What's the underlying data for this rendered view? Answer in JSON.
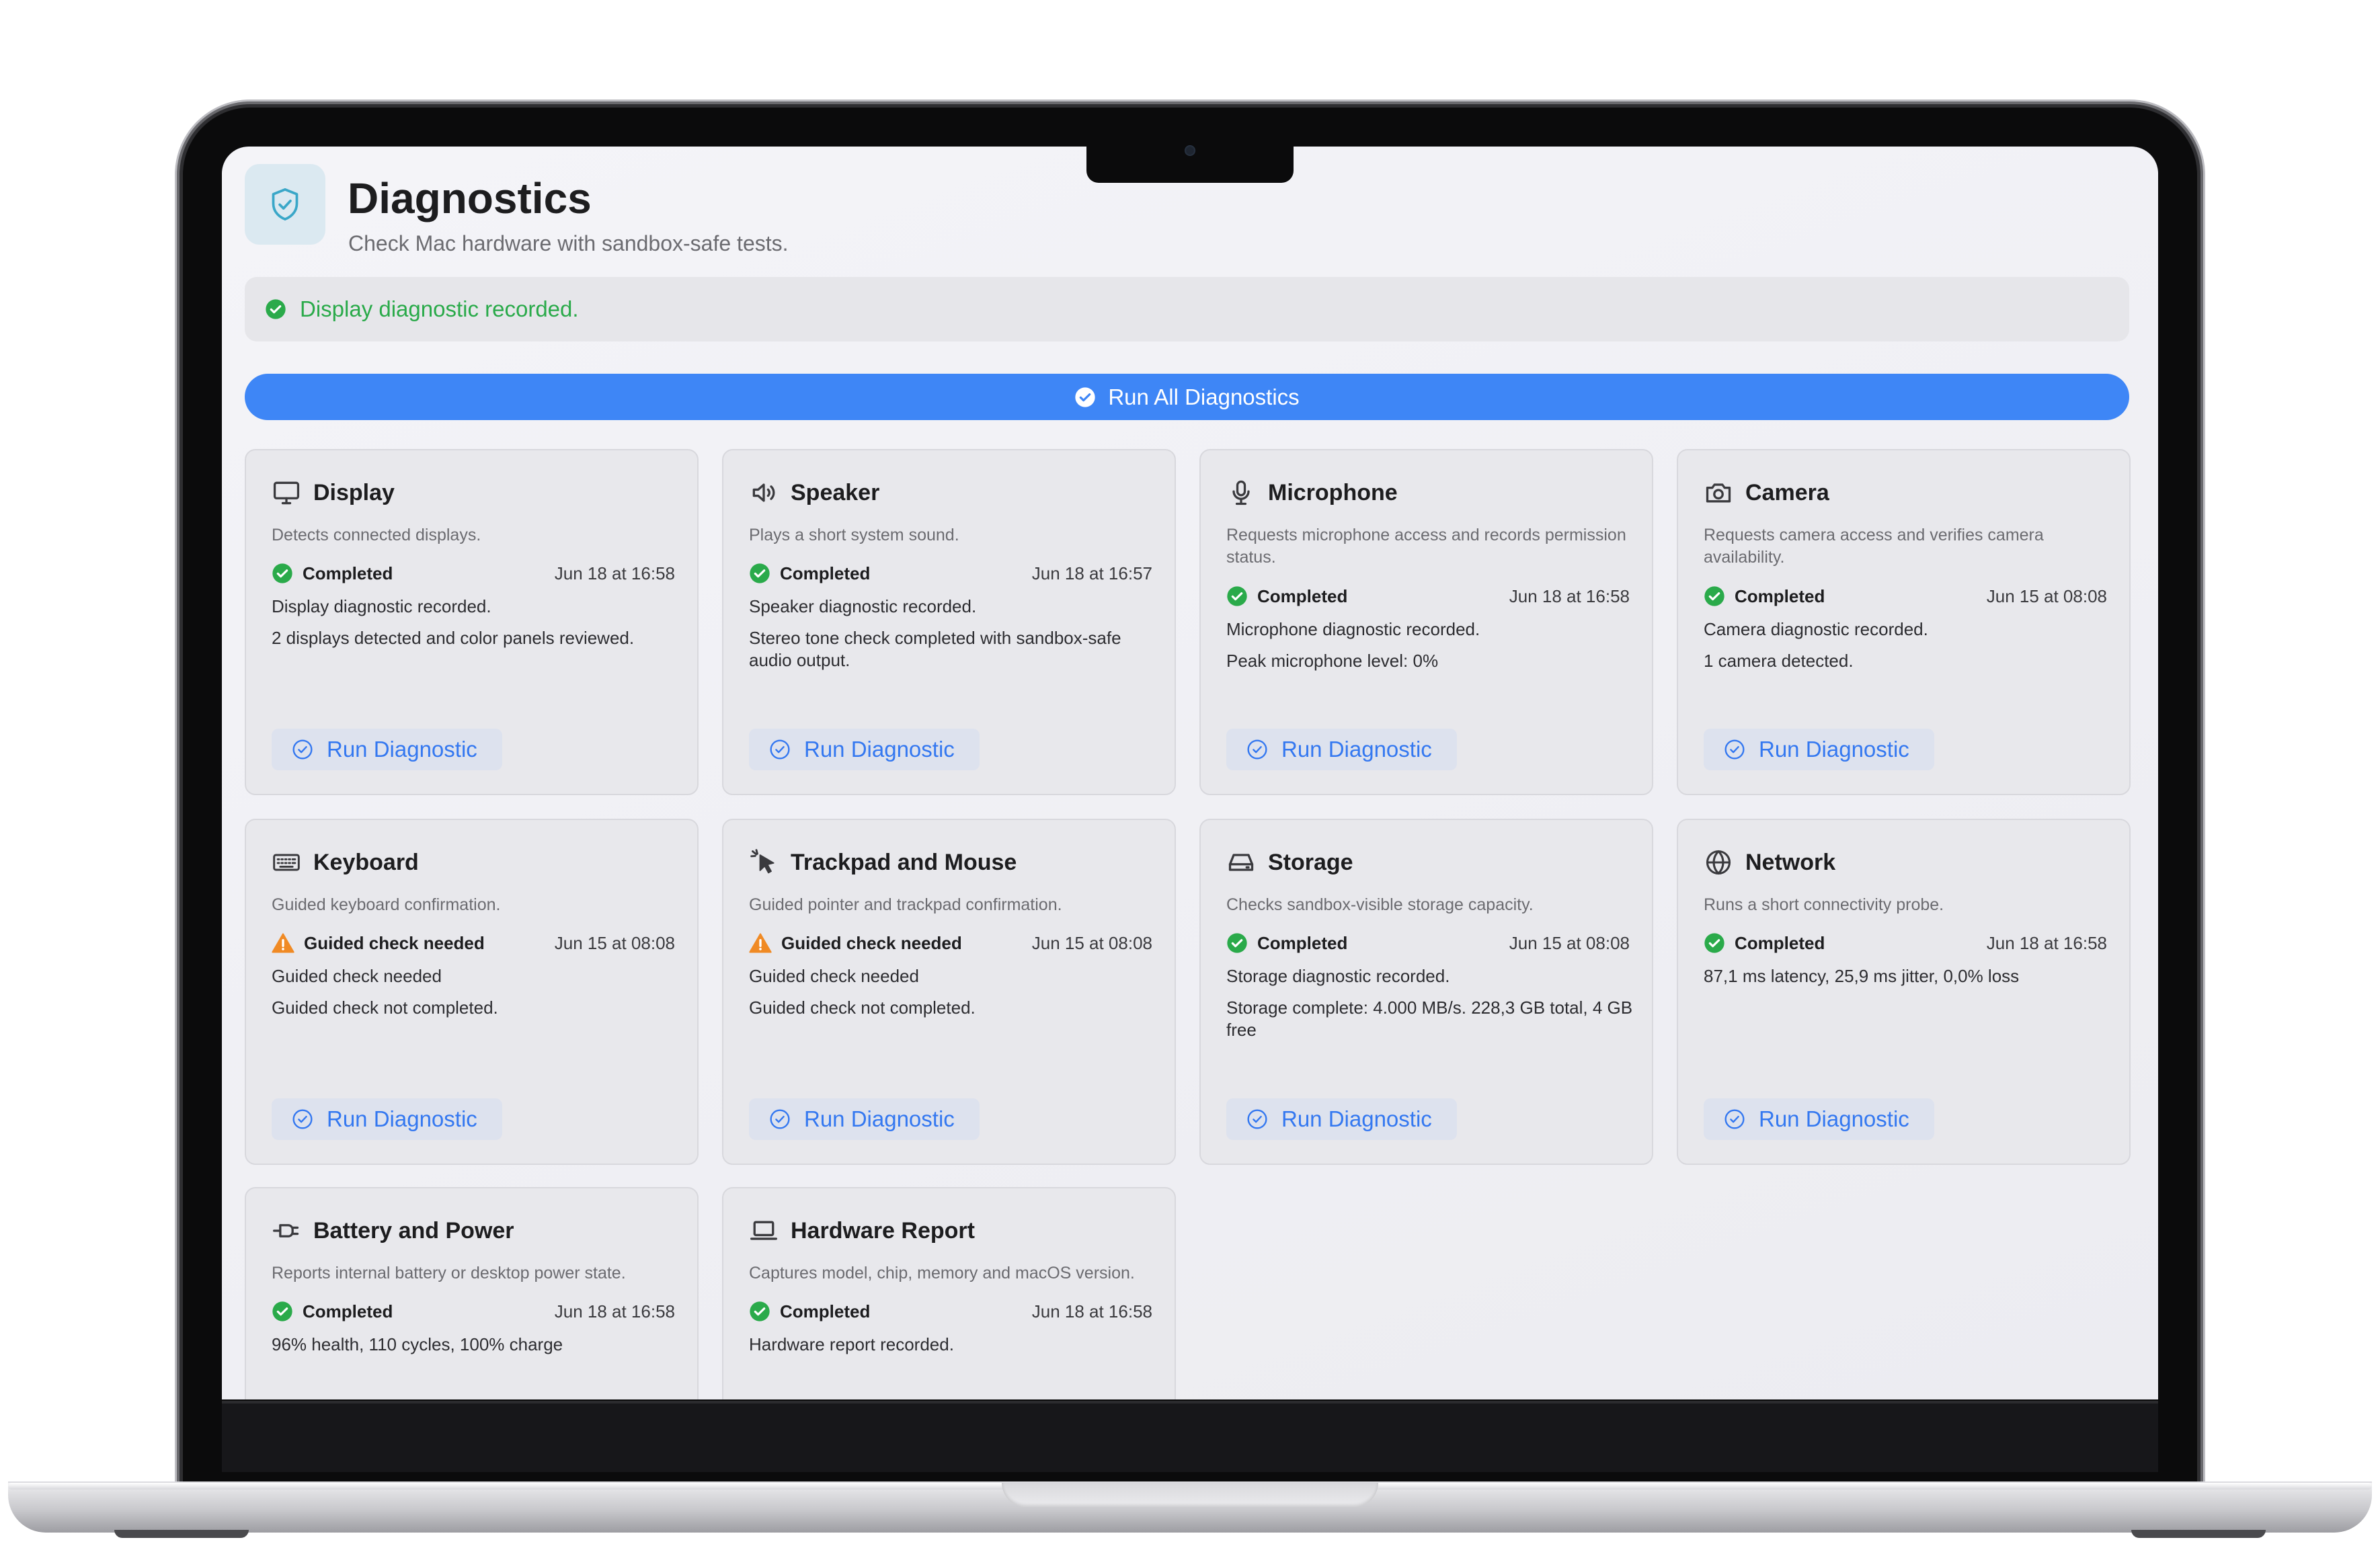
{
  "app": {
    "title": "Diagnostics",
    "subtitle": "Check Mac hardware with sandbox-safe tests.",
    "icon": "shield-check-icon",
    "accent": "#3e86f6",
    "success_color": "#2aaa4a",
    "warning_color": "#f08a24"
  },
  "banner": {
    "text": "Display diagnostic recorded.",
    "icon": "check-circle-icon"
  },
  "run_all": {
    "label": "Run All Diagnostics",
    "icon": "check-circle-icon"
  },
  "cards": [
    {
      "title": "Display",
      "icon": "display-icon",
      "description": "Detects connected displays.",
      "status": "Completed",
      "status_type": "success",
      "time": "Jun 18 at 16:58",
      "line1": "Display diagnostic recorded.",
      "line2": "2 displays detected and color panels reviewed.",
      "button": "Run Diagnostic"
    },
    {
      "title": "Speaker",
      "icon": "speaker-icon",
      "description": "Plays a short system sound.",
      "status": "Completed",
      "status_type": "success",
      "time": "Jun 18 at 16:57",
      "line1": "Speaker diagnostic recorded.",
      "line2": "Stereo tone check completed with sandbox-safe audio output.",
      "button": "Run Diagnostic"
    },
    {
      "title": "Microphone",
      "icon": "microphone-icon",
      "description": "Requests microphone access and records permission status.",
      "status": "Completed",
      "status_type": "success",
      "time": "Jun 18 at 16:58",
      "line1": "Microphone diagnostic recorded.",
      "line2": "Peak microphone level: 0%",
      "button": "Run Diagnostic"
    },
    {
      "title": "Camera",
      "icon": "camera-icon",
      "description": "Requests camera access and verifies camera availability.",
      "status": "Completed",
      "status_type": "success",
      "time": "Jun 15 at 08:08",
      "line1": "Camera diagnostic recorded.",
      "line2": "1 camera detected.",
      "button": "Run Diagnostic"
    },
    {
      "title": "Keyboard",
      "icon": "keyboard-icon",
      "description": "Guided keyboard confirmation.",
      "status": "Guided check needed",
      "status_type": "warning",
      "time": "Jun 15 at 08:08",
      "line1": "Guided check needed",
      "line2": "Guided check not completed.",
      "button": "Run Diagnostic"
    },
    {
      "title": "Trackpad and Mouse",
      "icon": "pointer-icon",
      "description": "Guided pointer and trackpad confirmation.",
      "status": "Guided check needed",
      "status_type": "warning",
      "time": "Jun 15 at 08:08",
      "line1": "Guided check needed",
      "line2": "Guided check not completed.",
      "button": "Run Diagnostic"
    },
    {
      "title": "Storage",
      "icon": "storage-drive-icon",
      "description": "Checks sandbox-visible storage capacity.",
      "status": "Completed",
      "status_type": "success",
      "time": "Jun 15 at 08:08",
      "line1": "Storage diagnostic recorded.",
      "line2": "Storage complete: 4.000 MB/s. 228,3 GB total, 4 GB free",
      "button": "Run Diagnostic"
    },
    {
      "title": "Network",
      "icon": "globe-icon",
      "description": "Runs a short connectivity probe.",
      "status": "Completed",
      "status_type": "success",
      "time": "Jun 18 at 16:58",
      "line1": "87,1 ms latency, 25,9 ms jitter, 0,0% loss",
      "line2": "",
      "button": "Run Diagnostic"
    },
    {
      "title": "Battery and Power",
      "icon": "power-plug-icon",
      "description": "Reports internal battery or desktop power state.",
      "status": "Completed",
      "status_type": "success",
      "time": "Jun 18 at 16:58",
      "line1": "96% health, 110 cycles, 100% charge",
      "line2": "",
      "button": ""
    },
    {
      "title": "Hardware Report",
      "icon": "laptop-icon",
      "description": "Captures model, chip, memory and macOS version.",
      "status": "Completed",
      "status_type": "success",
      "time": "Jun 18 at 16:58",
      "line1": "Hardware report recorded.",
      "line2": "",
      "button": ""
    }
  ]
}
